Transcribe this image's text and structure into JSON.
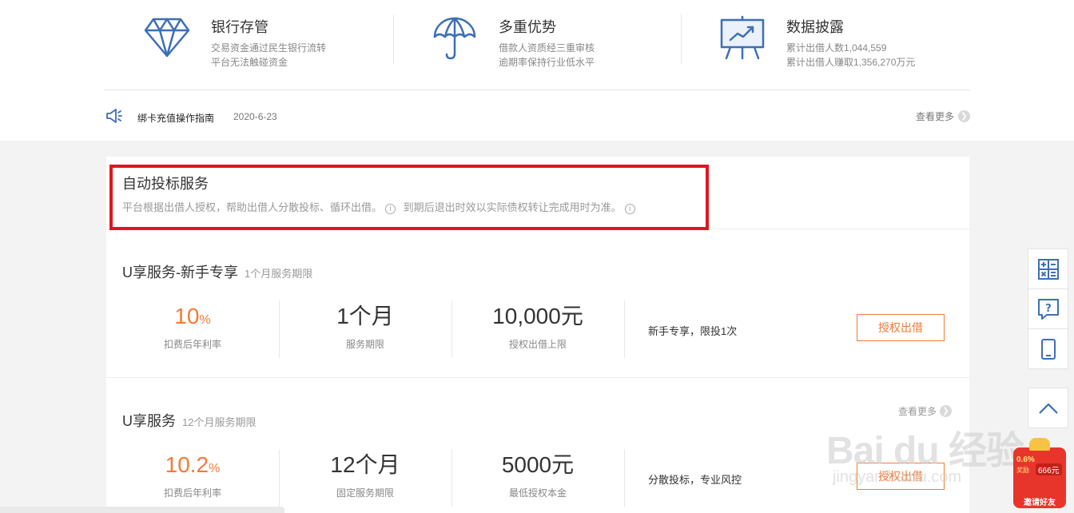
{
  "features": [
    {
      "title": "银行存管",
      "line1": "交易资金通过民生银行流转",
      "line2": "平台无法触碰资金",
      "icon": "diamond-icon"
    },
    {
      "title": "多重优势",
      "line1": "借款人资质经三重审核",
      "line2": "逾期率保持行业低水平",
      "icon": "umbrella-icon"
    },
    {
      "title": "数据披露",
      "line1": "累计出借人数1,044,559",
      "line2": "累计出借人赚取1,356,270万元",
      "icon": "presentation-board-icon"
    }
  ],
  "notice": {
    "text": "绑卡充值操作指南",
    "date": "2020-6-23",
    "more": "查看更多"
  },
  "service": {
    "title": "自动投标服务",
    "desc1": "平台根据出借人授权，帮助出借人分散投标、循环出借。",
    "desc2": "到期后退出时效以实际债权转让完成用时为准。"
  },
  "products": [
    {
      "name": "U享服务-新手专享",
      "term": "1个月服务期限",
      "rate": "10",
      "rate_unit": "%",
      "rate_label": "扣费后年利率",
      "period": "1个月",
      "period_label": "服务期限",
      "amount": "10,000元",
      "amount_label": "授权出借上限",
      "note": "新手专享，限投1次",
      "button": "授权出借"
    },
    {
      "name": "U享服务",
      "term": "12个月服务期限",
      "rate": "10.2",
      "rate_unit": "%",
      "rate_label": "扣费后年利率",
      "period": "12个月",
      "period_label": "固定服务期限",
      "amount": "5000元",
      "amount_label": "最低授权本金",
      "note": "分散投标，专业风控",
      "button": "授权出借",
      "more": "查看更多"
    }
  ],
  "watermark": {
    "line1": "Bai du 经验",
    "line2": "jingyan.baidu.com"
  },
  "badge": {
    "rate": "0.6%",
    "sub": "奖励",
    "amount": "666元",
    "label": "邀请好友"
  },
  "colors": {
    "accent": "#f27b36",
    "icon_blue": "#3d6fb5",
    "highlight": "#e0161f"
  }
}
